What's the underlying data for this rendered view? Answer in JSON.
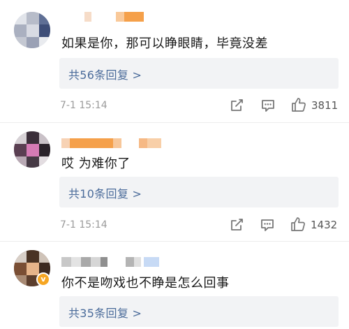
{
  "comments": [
    {
      "text": "如果是你，那可以睁眼睛，毕竟没差",
      "replies_label": "共56条回复 >",
      "timestamp": "7-1 15:14",
      "likes": "3811",
      "verified": false
    },
    {
      "text": "哎  为难你了",
      "replies_label": "共10条回复 >",
      "timestamp": "7-1 15:14",
      "likes": "1432",
      "verified": false
    },
    {
      "text": "你不是吻戏也不睁是怎么回事",
      "replies_label": "共35条回复 >",
      "verified": true,
      "verified_badge": "v"
    }
  ],
  "icons": {
    "share": "share-icon",
    "comment": "comment-icon",
    "like": "like-icon"
  },
  "colors": {
    "reply_link": "#4a6b9a",
    "reply_bg": "#f2f3f5",
    "meta_text": "#9a9a9a",
    "verified_badge": "#f6a623",
    "name_highlight": "#f5a04a"
  }
}
